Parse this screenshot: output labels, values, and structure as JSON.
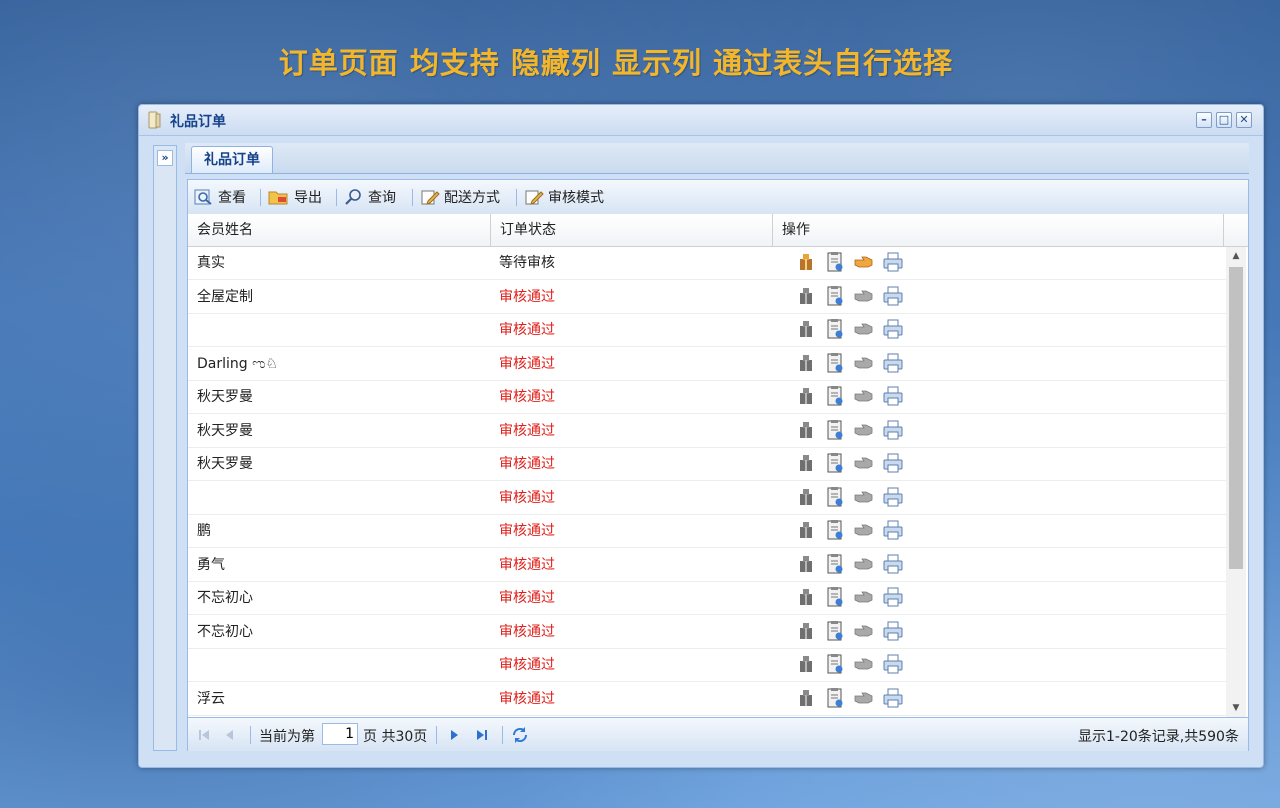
{
  "headline": "订单页面 均支持 隐藏列 显示列  通过表头自行选择",
  "window": {
    "title": "礼品订单",
    "minimize_icon": "minimize-icon",
    "maximize_icon": "maximize-icon",
    "close_icon": "close-icon"
  },
  "sidebar": {
    "expand_label": "»"
  },
  "tabs": [
    {
      "label": "礼品订单"
    }
  ],
  "toolbar": {
    "view_label": "查看",
    "export_label": "导出",
    "query_label": "查询",
    "delivery_label": "配送方式",
    "audit_mode_label": "审核模式"
  },
  "grid": {
    "columns": [
      "会员姓名",
      "订单状态",
      "操作"
    ],
    "rows": [
      {
        "name": "真实",
        "status": "等待审核",
        "pending": true
      },
      {
        "name": "全屋定制",
        "status": "审核通过",
        "pending": false
      },
      {
        "name": "",
        "status": "审核通过",
        "pending": false
      },
      {
        "name": "Darling ಌ♘",
        "status": "审核通过",
        "pending": false
      },
      {
        "name": "秋天罗曼",
        "status": "审核通过",
        "pending": false
      },
      {
        "name": "秋天罗曼",
        "status": "审核通过",
        "pending": false
      },
      {
        "name": "秋天罗曼",
        "status": "审核通过",
        "pending": false
      },
      {
        "name": "",
        "status": "审核通过",
        "pending": false
      },
      {
        "name": "鹏",
        "status": "审核通过",
        "pending": false
      },
      {
        "name": "勇气",
        "status": "审核通过",
        "pending": false
      },
      {
        "name": "不忘初心",
        "status": "审核通过",
        "pending": false
      },
      {
        "name": "不忘初心",
        "status": "审核通过",
        "pending": false
      },
      {
        "name": "",
        "status": "审核通过",
        "pending": false
      },
      {
        "name": "浮云",
        "status": "审核通过",
        "pending": false
      }
    ],
    "op_icons": [
      "ship-icon",
      "order-detail-icon",
      "audit-hand-icon",
      "print-icon"
    ]
  },
  "pager": {
    "current_prefix": "当前为第",
    "page_value": "1",
    "page_suffix": "页 共30页",
    "summary": "显示1-20条记录,共590条"
  },
  "colors": {
    "headline": "#f3b62a",
    "status_ok": "#e0201a",
    "title_blue": "#15428b",
    "border": "#99bbe8"
  }
}
